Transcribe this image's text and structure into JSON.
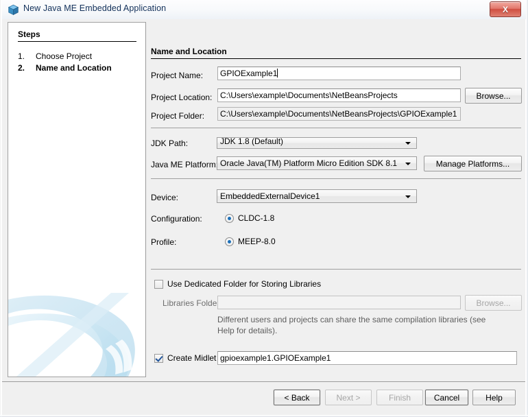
{
  "window": {
    "title": "New Java ME Embedded Application",
    "icon": "java-cube-icon",
    "close_label": "X"
  },
  "steps_panel": {
    "heading": "Steps",
    "items": [
      {
        "number": "1.",
        "label": "Choose Project",
        "active": false
      },
      {
        "number": "2.",
        "label": "Name and Location",
        "active": true
      }
    ]
  },
  "content": {
    "section_title": "Name and Location",
    "project_name": {
      "label": "Project Name:",
      "value": "GPIOExample1",
      "placeholder": ""
    },
    "project_location": {
      "label": "Project Location:",
      "value": "C:\\Users\\example\\Documents\\NetBeansProjects",
      "browse_label": "Browse..."
    },
    "project_folder": {
      "label": "Project Folder:",
      "value": "C:\\Users\\example\\Documents\\NetBeansProjects\\GPIOExample1"
    },
    "jdk_path": {
      "label": "JDK Path:",
      "value": "JDK 1.8 (Default)"
    },
    "java_me_platform": {
      "label": "Java ME Platform:",
      "value": "Oracle Java(TM) Platform Micro Edition SDK 8.1",
      "manage_label": "Manage Platforms..."
    },
    "device": {
      "label": "Device:",
      "value": "EmbeddedExternalDevice1"
    },
    "configuration": {
      "label": "Configuration:",
      "option": "CLDC-1.8",
      "checked": true
    },
    "profile": {
      "label": "Profile:",
      "option": "MEEP-8.0",
      "checked": true
    },
    "dedicated_folder": {
      "label": "Use Dedicated Folder for Storing Libraries",
      "checked": false
    },
    "libraries_folder": {
      "label": "Libraries Folder:",
      "value": "",
      "browse_label": "Browse..."
    },
    "libraries_help": "Different users and projects can share the same compilation libraries (see Help for details).",
    "create_midlet": {
      "label": "Create Midlet",
      "checked": true,
      "value": "gpioexample1.GPIOExample1"
    }
  },
  "buttonbar": {
    "back": "< Back",
    "next": "Next >",
    "finish": "Finish",
    "cancel": "Cancel",
    "help": "Help"
  },
  "colors": {
    "accent_blue": "#1c6fb8",
    "title_text": "#12305a",
    "close_red": "#cf4f41",
    "panel_bg": "#f0f0f0"
  }
}
